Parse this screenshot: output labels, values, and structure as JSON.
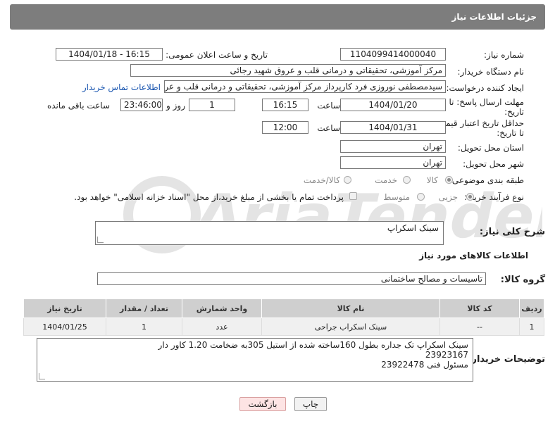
{
  "header": {
    "title": "جزئیات اطلاعات نیاز"
  },
  "fields": {
    "need_number": {
      "label": "شماره نیاز:",
      "value": "1104099414000040"
    },
    "announce": {
      "label": "تاریخ و ساعت اعلان عمومی:",
      "value": "1404/01/18 - 16:15"
    },
    "buyer_org": {
      "label": "نام دستگاه خریدار:",
      "value": "مرکز آموزشی، تحقیقاتی و درمانی قلب و عروق شهید رجائی"
    },
    "requester": {
      "label": "ایجاد کننده درخواست:",
      "value": "سیدمصطفی نوروزی فرد کارپرداز مرکز آموزشی، تحقیقاتی و درمانی قلب و عروق",
      "contact_link": "اطلاعات تماس خریدار"
    },
    "deadline": {
      "label": "مهلت ارسال پاسخ: تا تاریخ:",
      "date": "1404/01/20",
      "time_label": "ساعت",
      "time": "16:15",
      "days": "1",
      "days_label": "روز و",
      "remaining": "23:46:00",
      "remaining_label": "ساعت باقی مانده"
    },
    "price_validity": {
      "label": "حداقل تاریخ اعتبار قیمت: تا تاریخ:",
      "date": "1404/01/31",
      "time_label": "ساعت",
      "time": "12:00"
    },
    "province": {
      "label": "استان محل تحویل:",
      "value": "تهران"
    },
    "city": {
      "label": "شهر محل تحویل:",
      "value": "تهران"
    },
    "category": {
      "label": "طبقه بندی موضوعی:",
      "options": [
        "کالا",
        "خدمت",
        "کالا/خدمت"
      ]
    },
    "process": {
      "label": "نوع فرآیند خرید :",
      "options": [
        "جزیی",
        "متوسط"
      ],
      "note": "پرداخت تمام یا بخشی از مبلغ خرید،از محل \"اسناد خزانه اسلامی\" خواهد بود."
    },
    "description": {
      "label": "شرح کلی نیاز:",
      "value": "سینک اسکراپ"
    }
  },
  "goods": {
    "section_title": "اطلاعات کالاهای مورد نیاز",
    "group_label": "گروه کالا:",
    "group_value": "تاسیسات و مصالح ساختمانی",
    "columns": [
      "ردیف",
      "کد کالا",
      "نام کالا",
      "واحد شمارش",
      "تعداد / مقدار",
      "تاریخ نیاز"
    ],
    "rows": [
      [
        "1",
        "--",
        "سینک اسکراب جراحی",
        "عدد",
        "1",
        "1404/01/25"
      ]
    ]
  },
  "buyer_notes": {
    "label": "توضیحات خریدار:",
    "lines": [
      "سینک اسکراپ تک جداره بطول 160ساخته شده از استیل 305به ضخامت 1.20 کاور دار",
      "23923167",
      "مسئول فنی 23922478"
    ]
  },
  "buttons": {
    "print": "چاپ",
    "back": "بازگشت"
  },
  "watermark": {
    "text": "AriaTender.neT"
  },
  "colors": {
    "header_bg": "#7d7d7d",
    "link": "#1a56b0",
    "table_header": "#cfcfcf",
    "back_button_bg": "#fde4e4"
  }
}
